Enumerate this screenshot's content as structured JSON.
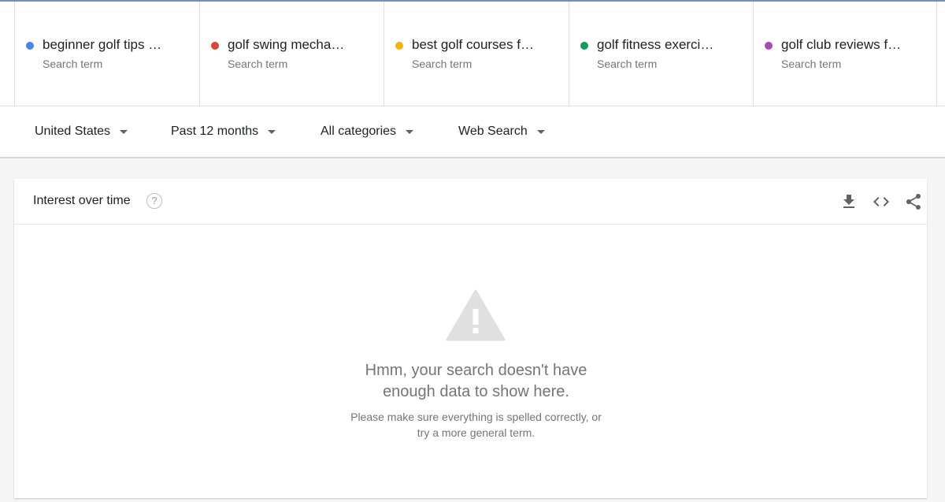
{
  "search_terms": [
    {
      "label": "beginner golf tips …",
      "type": "Search term",
      "color": "#4285f4"
    },
    {
      "label": "golf swing mecha…",
      "type": "Search term",
      "color": "#db4437"
    },
    {
      "label": "best golf courses f…",
      "type": "Search term",
      "color": "#f4b400"
    },
    {
      "label": "golf fitness exerci…",
      "type": "Search term",
      "color": "#0f9d58"
    },
    {
      "label": "golf club reviews f…",
      "type": "Search term",
      "color": "#ab47bc"
    }
  ],
  "filters": {
    "region": "United States",
    "time_range": "Past 12 months",
    "category": "All categories",
    "search_type": "Web Search"
  },
  "panel": {
    "title": "Interest over time",
    "help_symbol": "?",
    "tools": [
      "download-icon",
      "embed-code-icon",
      "share-icon"
    ],
    "empty_state": {
      "message_line1": "Hmm, your search doesn't have",
      "message_line2": "enough data to show here.",
      "hint_line1": "Please make sure everything is spelled correctly, or",
      "hint_line2": "try a more general term."
    }
  }
}
